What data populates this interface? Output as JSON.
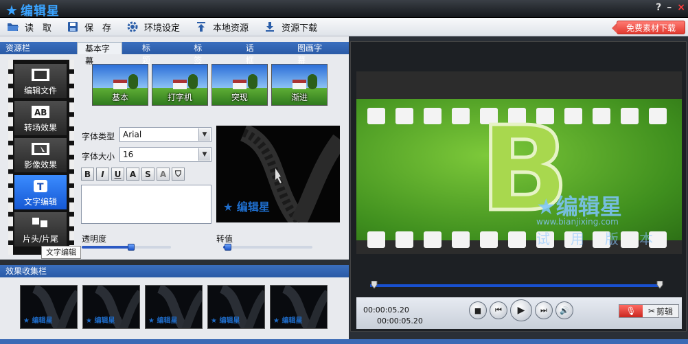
{
  "app": {
    "title": "编辑星",
    "window_controls": [
      "?",
      "–",
      "×"
    ]
  },
  "toolbar": {
    "items": [
      {
        "label": "读　取",
        "icon": "folder-open-icon"
      },
      {
        "label": "保　存",
        "icon": "floppy-disk-icon"
      },
      {
        "label": "环境设定",
        "icon": "gear-icon"
      },
      {
        "label": "本地资源",
        "icon": "upload-arrow-icon"
      },
      {
        "label": "资源下载",
        "icon": "download-arrow-icon"
      }
    ],
    "free_download": "免费素材下载"
  },
  "resource_panel": {
    "header": "资源栏",
    "tabs": [
      "基本字幕",
      "标　题",
      "标　签",
      "话　框",
      "图画字幕"
    ],
    "active_tab": 0
  },
  "sidebar": {
    "items": [
      {
        "label": "编辑文件",
        "icon": "film-icon"
      },
      {
        "label": "转场效果",
        "icon": "ab-transition-icon"
      },
      {
        "label": "影像效果",
        "icon": "effect-film-icon"
      },
      {
        "label": "文字编辑",
        "icon": "text-t-icon"
      },
      {
        "label": "片头/片尾",
        "icon": "squares-icon"
      }
    ],
    "active_index": 3,
    "tooltip": "文字编辑"
  },
  "subtitle_presets": [
    "基本",
    "打字机",
    "突现",
    "渐进"
  ],
  "font": {
    "type_label": "字体类型",
    "type_value": "Arial",
    "size_label": "字体大小",
    "size_value": "16"
  },
  "format_buttons": [
    "B",
    "I",
    "U",
    "A",
    "S",
    "A",
    "⛉"
  ],
  "preview_watermark": "编辑星",
  "sliders": {
    "opacity_label": "透明度",
    "opacity_value": 0.55,
    "rotate_label": "转值",
    "rotate_value": 0.05
  },
  "collect_panel": {
    "header": "效果收集栏",
    "tile_watermark": "编辑星",
    "tile_count": 5
  },
  "player": {
    "watermark": "编辑星",
    "watermark_url": "www.bianjixing.com",
    "watermark_sub": "试用版本",
    "big_letter": "B",
    "time_current": "00:00:05.20",
    "time_total": "00:00:05.20",
    "seek_position": 1.0,
    "buttons": [
      "stop",
      "prev",
      "play",
      "next",
      "volume"
    ],
    "cut_label": "剪辑"
  }
}
